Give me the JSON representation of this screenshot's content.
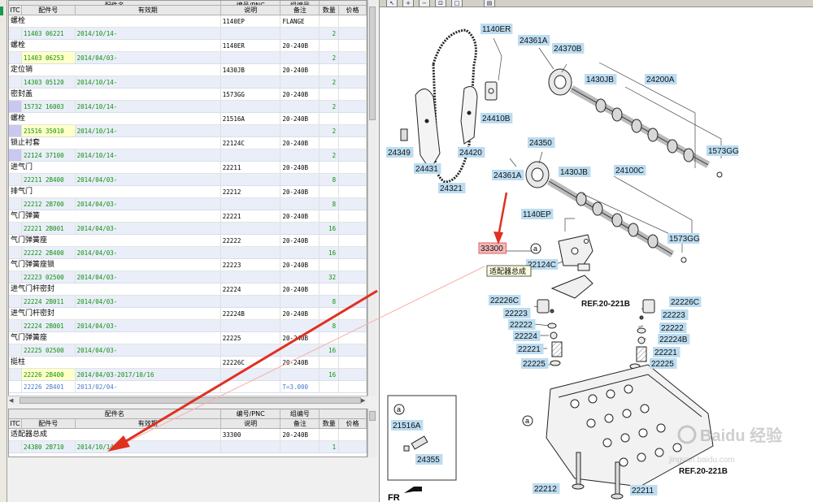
{
  "upper_table": {
    "top_headers": [
      "配件名",
      "编号/PNC",
      "组编号"
    ],
    "headers": [
      "ITC",
      "配件号",
      "有效期",
      "说明",
      "备注",
      "数量",
      "价格"
    ],
    "rows": [
      {
        "name": "螺栓",
        "pno": "11403 06221",
        "eff": "2014/10/14-",
        "desc": "1140EP",
        "rem": "FLANGE",
        "qty": "2"
      },
      {
        "name": "螺栓",
        "pno": "11403 06253",
        "eff": "2014/04/03-",
        "desc": "1140ER",
        "rem": "20-240B",
        "qty": "2"
      },
      {
        "name": "定位销",
        "pno": "14303 05120",
        "eff": "2014/10/14-",
        "desc": "1430JB",
        "rem": "20-240B",
        "qty": "2"
      },
      {
        "name": "密封盖",
        "pno": "15732 16003",
        "eff": "2014/10/14-",
        "desc": "1573GG",
        "rem": "20-240B",
        "qty": "2"
      },
      {
        "name": "螺栓",
        "pno": "21516 35010",
        "eff": "2014/10/14-",
        "desc": "21516A",
        "rem": "20-240B",
        "qty": "2"
      },
      {
        "name": "锁止衬套",
        "pno": "22124 37100",
        "eff": "2014/10/14-",
        "desc": "22124C",
        "rem": "20-240B",
        "qty": "2"
      },
      {
        "name": "进气门",
        "pno": "22211 2B400",
        "eff": "2014/04/03-",
        "desc": "22211",
        "rem": "20-240B",
        "qty": "8"
      },
      {
        "name": "排气门",
        "pno": "22212 2B700",
        "eff": "2014/04/03-",
        "desc": "22212",
        "rem": "20-240B",
        "qty": "8"
      },
      {
        "name": "气门弹簧",
        "pno": "22221 2B001",
        "eff": "2014/04/03-",
        "desc": "22221",
        "rem": "20-240B",
        "qty": "16"
      },
      {
        "name": "气门弹簧座",
        "pno": "22222 2B400",
        "eff": "2014/04/03-",
        "desc": "22222",
        "rem": "20-240B",
        "qty": "16"
      },
      {
        "name": "气门弹簧座锁",
        "pno": "22223 02500",
        "eff": "2014/04/03-",
        "desc": "22223",
        "rem": "20-240B",
        "qty": "32"
      },
      {
        "name": "进气门杆密封",
        "pno": "22224 2B011",
        "eff": "2014/04/03-",
        "desc": "22224",
        "rem": "20-240B",
        "qty": "8"
      },
      {
        "name": "进气门杆密封",
        "pno": "22224 2B001",
        "eff": "2014/04/03-",
        "desc": "22224B",
        "rem": "20-240B",
        "qty": "8"
      },
      {
        "name": "气门弹簧座",
        "pno": "22225 02500",
        "eff": "2014/04/03-",
        "desc": "22225",
        "rem": "20-240B",
        "qty": "16"
      },
      {
        "name": "挺柱",
        "pno": "22226 2B400",
        "eff": "2014/04/03-2017/10/16",
        "desc": "22226C",
        "rem": "20-240B",
        "qty": "16"
      }
    ],
    "last_row": {
      "pno": "22226 2B401",
      "eff": "2013/02/04-",
      "rem": "T=3.000"
    }
  },
  "lower_table": {
    "top_headers": [
      "配件名",
      "编号/PNC",
      "组编号"
    ],
    "headers": [
      "ITC",
      "配件号",
      "有效期",
      "说明",
      "备注",
      "数量",
      "价格"
    ],
    "row": {
      "name": "适配器总成",
      "pno": "24380 2B710",
      "eff": "2014/10/14-",
      "desc": "33300",
      "rem": "20-240B",
      "qty": "1"
    }
  },
  "toolbar_icons": [
    "pointer-icon",
    "zoom-in-icon",
    "zoom-out-icon",
    "zoom-fit-icon",
    "zoom-window-icon",
    "print-icon"
  ],
  "diagram": {
    "labels": {
      "l1140ER": "1140ER",
      "l24361A_1": "24361A",
      "l24370B": "24370B",
      "l1430JB_1": "1430JB",
      "l24200A": "24200A",
      "l24410B": "24410B",
      "l24349": "24349",
      "l24420": "24420",
      "l1573GG_1": "1573GG",
      "l24431": "24431",
      "l24350": "24350",
      "l24361A_2": "24361A",
      "l1430JB_2": "1430JB",
      "l24100C": "24100C",
      "l24321": "24321",
      "l1140EP": "1140EP",
      "l1573GG_2": "1573GG",
      "l33300": "33300",
      "l22124C": "22124C",
      "l22226C_1": "22226C",
      "l22226C_2": "22226C",
      "lREF1": "REF.20-221B",
      "l22223_1": "22223",
      "l22223_2": "22223",
      "l22222_1": "22222",
      "l22222_2": "22222",
      "l22224": "22224",
      "l22224B": "22224B",
      "l22221_1": "22221",
      "l22221_2": "22221",
      "l22225_1": "22225",
      "l22225_2": "22225",
      "l21516A": "21516A",
      "l24355": "24355",
      "lREF2": "REF.20-221B",
      "l22212": "22212",
      "l22211": "22211",
      "lFR": "FR",
      "la1": "a",
      "la2": "a",
      "la3": "a"
    },
    "tooltip": "适配器总成",
    "watermark": "Baidu 经验",
    "watermark_url": "jingyan.baidu.com"
  },
  "colors": {
    "highlight_label": "#bcdcf0",
    "selected_label": "#f4b8b8",
    "arrow": "#e03020",
    "green_text": "#109010"
  }
}
